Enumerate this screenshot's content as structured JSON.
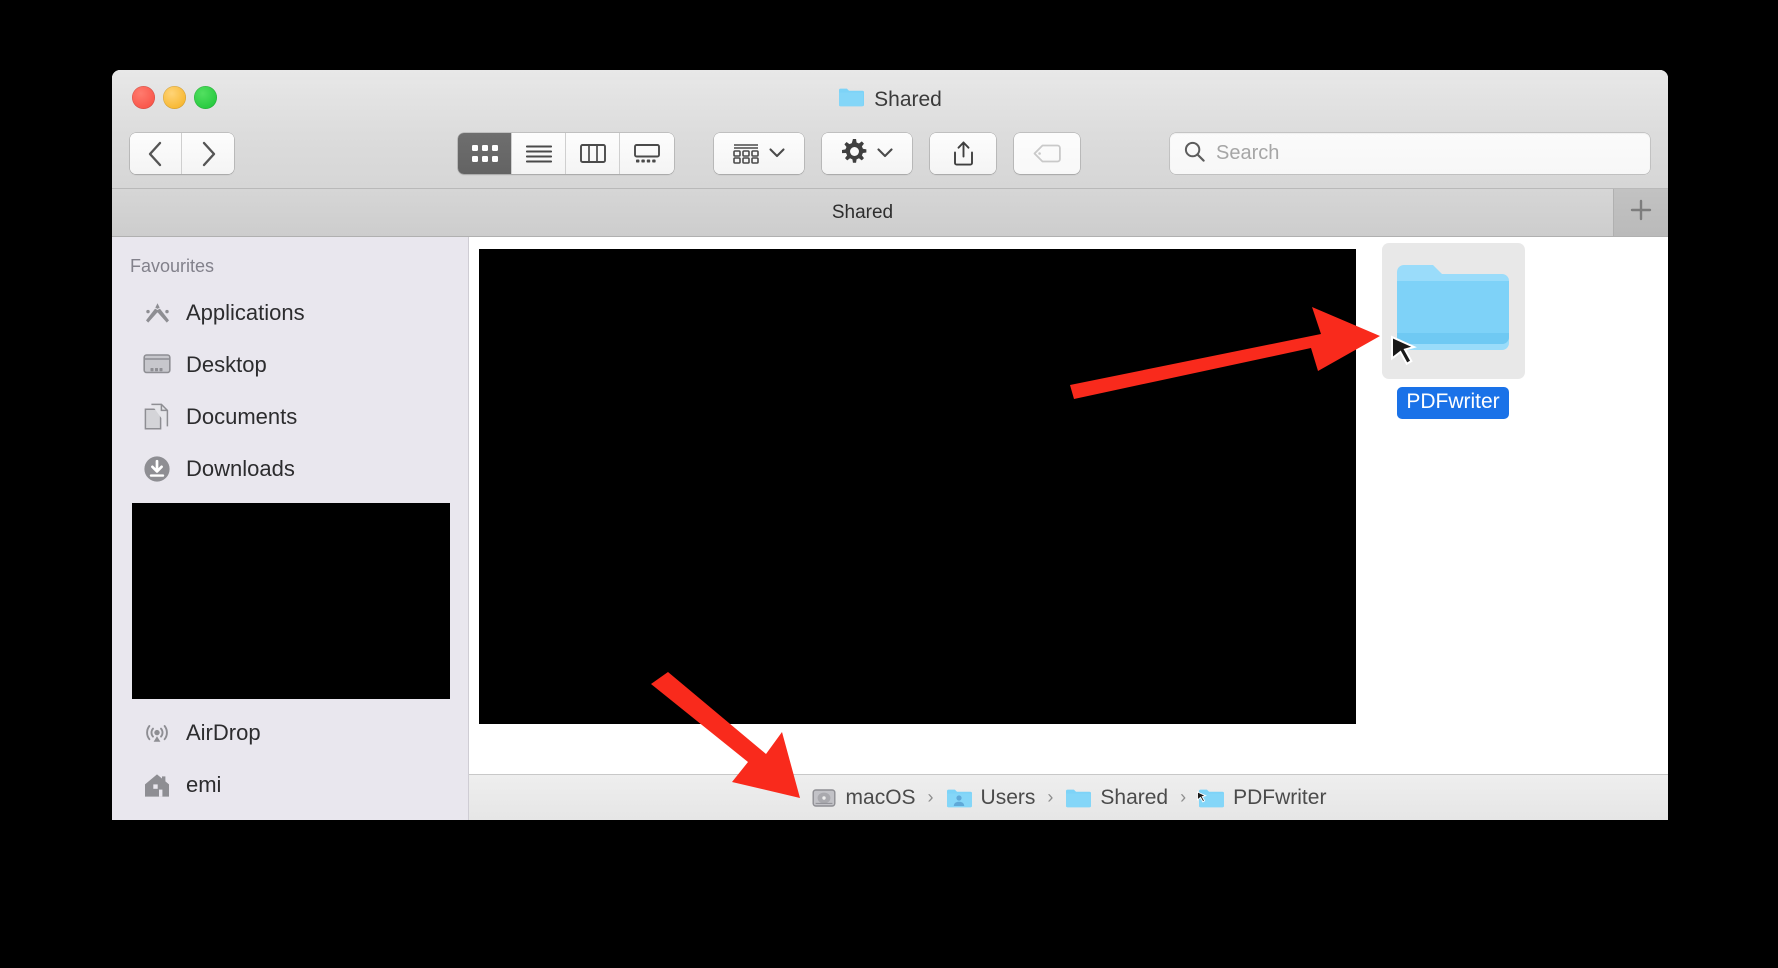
{
  "window": {
    "title": "Shared",
    "title_icon": "folder-icon",
    "traffic_lights": [
      {
        "name": "close",
        "color": "#f9564a"
      },
      {
        "name": "minimize",
        "color": "#f7b731"
      },
      {
        "name": "maximize",
        "color": "#27c93f"
      }
    ]
  },
  "toolbar": {
    "back_label": "Back",
    "forward_label": "Forward",
    "back_icon": "chevron-left-icon",
    "forward_icon": "chevron-right-icon",
    "view_modes": [
      {
        "name": "icon-view",
        "icon": "grid-icon",
        "active": true
      },
      {
        "name": "list-view",
        "icon": "list-icon",
        "active": false
      },
      {
        "name": "column-view",
        "icon": "columns-icon",
        "active": false
      },
      {
        "name": "gallery-view",
        "icon": "gallery-icon",
        "active": false
      }
    ],
    "arrange_icon": "group-icon",
    "arrange_chevron": "chevron-down-icon",
    "action_icon": "gear-icon",
    "action_chevron": "chevron-down-icon",
    "share_icon": "share-icon",
    "tag_icon": "tag-icon",
    "tag_disabled": true
  },
  "search": {
    "placeholder": "Search",
    "value": "",
    "icon": "search-icon"
  },
  "tabbar": {
    "active_tab": "Shared",
    "new_tab_label": "+",
    "new_tab_icon": "plus-icon"
  },
  "sidebar": {
    "section_header": "Favourites",
    "items": [
      {
        "label": "Applications",
        "icon": "applications-icon"
      },
      {
        "label": "Desktop",
        "icon": "desktop-icon"
      },
      {
        "label": "Documents",
        "icon": "documents-icon"
      },
      {
        "label": "Downloads",
        "icon": "downloads-icon"
      },
      {
        "label": "AirDrop",
        "icon": "airdrop-icon"
      },
      {
        "label": "emi",
        "icon": "home-icon"
      }
    ],
    "redacted_block": true
  },
  "content": {
    "redacted_block": true,
    "files": [
      {
        "name": "PDFwriter",
        "icon": "folder-icon",
        "selected": true,
        "selection_color": "#1a72e8",
        "has_cursor_overlay": true
      }
    ]
  },
  "pathbar": {
    "crumbs": [
      {
        "label": "macOS",
        "icon": "harddisk-icon"
      },
      {
        "label": "Users",
        "icon": "users-folder-icon"
      },
      {
        "label": "Shared",
        "icon": "folder-icon"
      },
      {
        "label": "PDFwriter",
        "icon": "folder-icon"
      }
    ],
    "separator": "›"
  },
  "annotations": {
    "color": "#f92a1c",
    "arrows": [
      {
        "name": "arrow-to-pdfwriter-folder",
        "direction": "right"
      },
      {
        "name": "arrow-to-path-bar",
        "direction": "down-right"
      }
    ]
  }
}
